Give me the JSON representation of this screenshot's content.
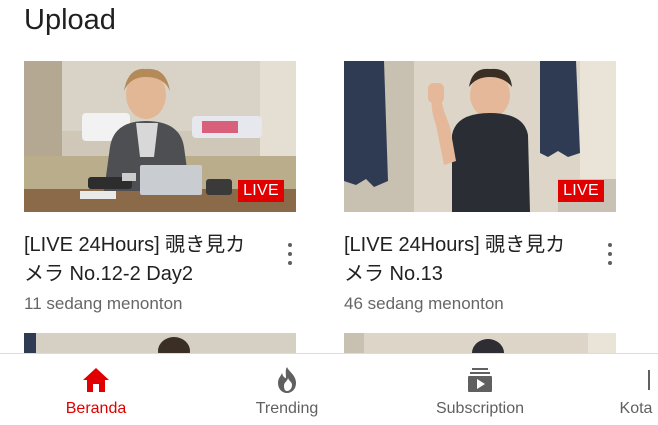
{
  "section": {
    "title": "Upload"
  },
  "videos": [
    {
      "title": "[LIVE 24Hours] 覗き見カメラ No.12-2 Day2",
      "subtitle": "11 sedang menonton",
      "badge": "LIVE"
    },
    {
      "title": "[LIVE 24Hours] 覗き見カメラ No.13",
      "subtitle": "46 sedang menonton",
      "badge": "LIVE"
    }
  ],
  "nav": {
    "items": [
      {
        "label": "Beranda",
        "icon": "home-icon",
        "active": true
      },
      {
        "label": "Trending",
        "icon": "flame-icon",
        "active": false
      },
      {
        "label": "Subscription",
        "icon": "subscriptions-icon",
        "active": false
      },
      {
        "label": "Kota",
        "icon": "inbox-icon",
        "active": false
      }
    ]
  },
  "colors": {
    "accent": "#e00000",
    "text": "#212121",
    "secondary": "#666666"
  }
}
